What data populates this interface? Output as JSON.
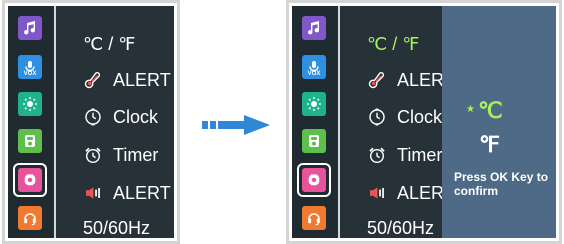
{
  "left": {
    "menu_items": [
      {
        "icon": "none",
        "label": "℃ / ℉"
      },
      {
        "icon": "thermometer-icon",
        "label": "ALERT"
      },
      {
        "icon": "clock-icon",
        "label": "Clock"
      },
      {
        "icon": "alarm-clock-icon",
        "label": "Timer"
      },
      {
        "icon": "speaker-icon",
        "label": "ALERT"
      },
      {
        "icon": "none",
        "label": "50/60Hz"
      }
    ]
  },
  "right": {
    "menu_items": [
      {
        "icon": "none",
        "label": "℃ / ℉"
      },
      {
        "icon": "thermometer-icon",
        "label": "ALERT"
      },
      {
        "icon": "clock-icon",
        "label": "Clock"
      },
      {
        "icon": "alarm-clock-icon",
        "label": "Timer"
      },
      {
        "icon": "speaker-icon",
        "label": "ALERT"
      },
      {
        "icon": "none",
        "label": "50/60Hz"
      }
    ],
    "options": {
      "celsius": "℃",
      "fahrenheit": "℉",
      "selected": "celsius"
    },
    "hint": "Press OK Key to confirm"
  },
  "sidebar_icons": [
    {
      "name": "music-icon",
      "color": "#7f57c9"
    },
    {
      "name": "mic-vox-icon",
      "label": "VOX",
      "color": "#2f8fe0"
    },
    {
      "name": "brightness-icon",
      "color": "#20b28f"
    },
    {
      "name": "storage-icon",
      "color": "#5fbf4d"
    },
    {
      "name": "settings-gear-icon",
      "color": "#e7549b"
    },
    {
      "name": "headset-icon",
      "color": "#f07a2f"
    }
  ],
  "colors": {
    "screen_bg": "#263238",
    "sidebar_bg": "#1f2a31",
    "highlight_green": "#a7f05a",
    "panel_bg": "#4f6a86",
    "arrow_blue": "#2f87d6",
    "selector_yellow": "#ffd400"
  }
}
